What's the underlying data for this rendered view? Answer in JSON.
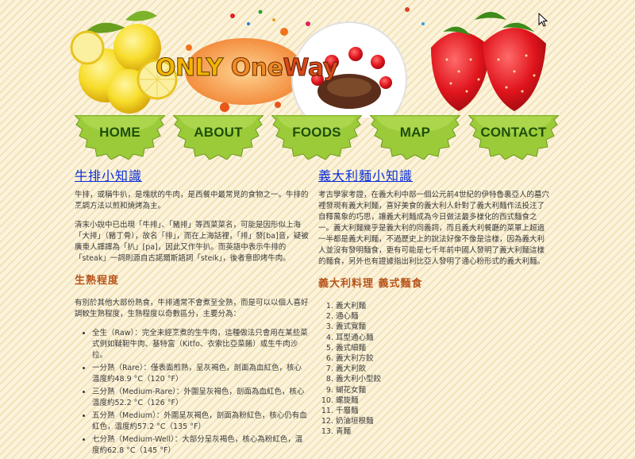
{
  "header": {
    "logo": {
      "only": "ONLY",
      "one": "One",
      "way": "Way"
    }
  },
  "nav": {
    "items": [
      {
        "label": "HOME"
      },
      {
        "label": "ABOUT"
      },
      {
        "label": "FOODS"
      },
      {
        "label": "MAP"
      },
      {
        "label": "CONTACT"
      }
    ]
  },
  "steak": {
    "title": "牛排小知識",
    "p1": "牛排，或稱牛扒，是塊狀的牛肉，是西餐中最常見的食物之一。牛排的烹調方法以煎和燒烤為主。",
    "p2": "清末小說中已出現「牛排」、「豬排」等西菜菜名，可能是因形似上海「大排」（豬丁骨），故名「排」，而在上海話裡，「排」發[ba]音，疑被廣東人譯譯為「扒」[pa]，因此又作牛扒。而英語中表示牛排的「steak」一詞則源自古諾爾斯語詞「steik」，後者意即烤牛肉。",
    "doneness_title": "生熟程度",
    "doneness_intro": "有別於其他大部份熟食，牛排通常不會煮至全熟，而是可以以個人喜好調較生熟程度，生熟程度以奇數區分，主要分為：",
    "levels": [
      "全生（Raw）：完全未經烹煮的生牛肉，這種做法只會用在某些菜式例如韃靼牛肉、基特富（Kitfo、衣索比亞菜餚）或生牛肉沙拉。",
      "一分熟（Rare）：僅表面煎熟，呈灰褐色，剖面為血紅色，核心溫度約48.9 °C（120 °F）",
      "三分熟（Medium-Rare）：外圍呈灰褐色，剖面為血紅色，核心溫度約52.2 °C（126 °F）",
      "五分熟（Medium）：外圍呈灰褐色，剖面為粉紅色，核心仍有血紅色，溫度約57.2 °C（135 °F）",
      "七分熟（Medium-Well）：大部分呈灰褐色，核心為粉紅色，溫度約62.8 °C（145 °F）"
    ]
  },
  "pasta": {
    "title": "義大利麵小知識",
    "p1": "考古學家考證，在義大利中部一個公元前4世紀的伊特魯裏亞人的墓穴裡發現有義大利麵，喜好美食的義大利人針對了義大利麵作法投注了自釋萬象的巧思，讓義大利麵成為今日做法最多樣化的西式麵食之一。義大利麵幾乎是義大利的同義詞，而且義大利餐廳的菜單上超過一半都是義大利麵，不過歷史上的說法好像不像是這樣，因為義大利人並沒有發明麵食，更有可能是七千年前中國人發明了義大利麵這樣的麵食，另外也有證據指出利比亞人發明了通心粉形式的義大利麵。",
    "dishes_title": "義大利料理 義式麵食",
    "dishes": [
      "義大利麵",
      "通心麵",
      "義式寬麵",
      "耳型通心麵",
      "義式細麵",
      "義大利方餃",
      "義大利飲",
      "義大利小型餃",
      "蝴花女麵",
      "螺旋麵",
      "千層麵",
      "奶油垣根麵",
      "青麵"
    ]
  }
}
